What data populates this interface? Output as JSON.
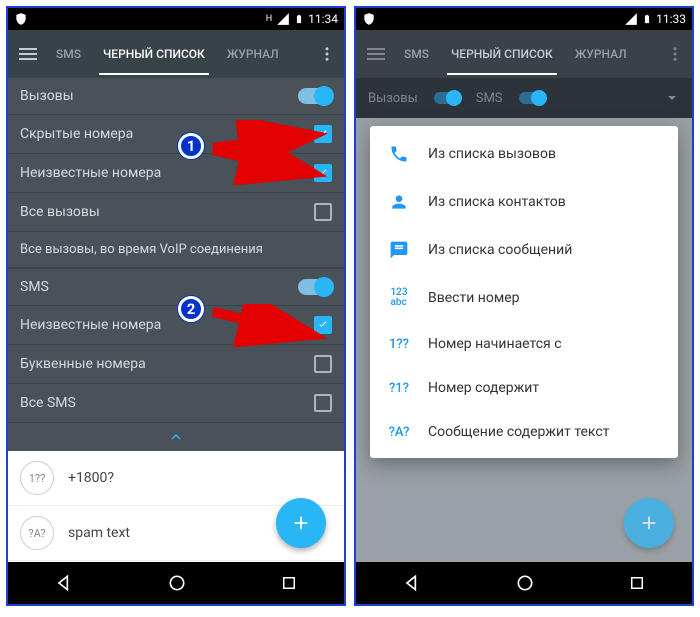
{
  "status": {
    "time_left": "11:34",
    "time_right": "11:33",
    "net": "H"
  },
  "tabs": {
    "sms": "SMS",
    "blacklist": "ЧЕРНЫЙ СПИСОК",
    "journal": "ЖУРНАЛ"
  },
  "left": {
    "calls_header": "Вызовы",
    "hidden_numbers": "Скрытые номера",
    "unknown_numbers": "Неизвестные номера",
    "all_calls": "Все вызовы",
    "all_calls_voip": "Все вызовы, во время VoIP соединения",
    "sms_header": "SMS",
    "sms_unknown": "Неизвестные номера",
    "sms_letter": "Буквенные номера",
    "sms_all": "Все SMS",
    "pattern_icon": "1??",
    "pattern_value": "+1800?",
    "text_icon": "?A?",
    "text_value": "spam text"
  },
  "right": {
    "subbar_calls": "Вызовы",
    "subbar_sms": "SMS",
    "menu": {
      "from_calls": "Из списка вызовов",
      "from_contacts": "Из списка контактов",
      "from_messages": "Из списка сообщений",
      "enter_number": "Ввести номер",
      "starts_with": "Номер начинается с",
      "contains": "Номер содержит",
      "msg_contains": "Сообщение содержит текст",
      "icon_enter": "123\nabc",
      "icon_starts": "1??",
      "icon_contains": "?1?",
      "icon_msg": "?A?"
    }
  },
  "badges": {
    "one": "1",
    "two": "2"
  }
}
